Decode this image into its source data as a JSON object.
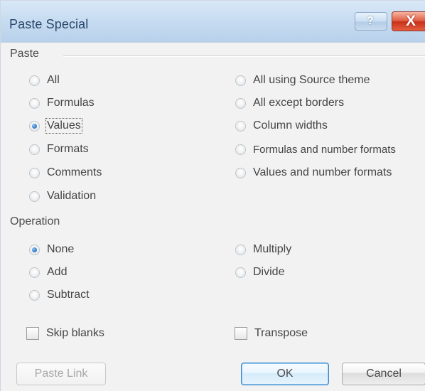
{
  "window": {
    "title": "Paste Special",
    "help_symbol": "?",
    "close_symbol": "X"
  },
  "paste": {
    "title": "Paste",
    "options_left": [
      {
        "label": "All",
        "selected": false
      },
      {
        "label": "Formulas",
        "selected": false
      },
      {
        "label": "Values",
        "selected": true
      },
      {
        "label": "Formats",
        "selected": false
      },
      {
        "label": "Comments",
        "selected": false
      },
      {
        "label": "Validation",
        "selected": false
      }
    ],
    "options_right": [
      {
        "label": "All using Source theme",
        "selected": false
      },
      {
        "label": "All except borders",
        "selected": false
      },
      {
        "label": "Column widths",
        "selected": false
      },
      {
        "label": "Formulas and number formats",
        "selected": false
      },
      {
        "label": "Values and number formats",
        "selected": false
      }
    ]
  },
  "operation": {
    "title": "Operation",
    "options_left": [
      {
        "label": "None",
        "selected": true
      },
      {
        "label": "Add",
        "selected": false
      },
      {
        "label": "Subtract",
        "selected": false
      }
    ],
    "options_right": [
      {
        "label": "Multiply",
        "selected": false
      },
      {
        "label": "Divide",
        "selected": false
      }
    ]
  },
  "checkboxes": {
    "skip_blanks": {
      "label": "Skip blanks",
      "checked": false
    },
    "transpose": {
      "label": "Transpose",
      "checked": false
    }
  },
  "buttons": {
    "paste_link": {
      "label": "Paste Link",
      "enabled": false
    },
    "ok": {
      "label": "OK",
      "enabled": true
    },
    "cancel": {
      "label": "Cancel",
      "enabled": true
    }
  },
  "colors": {
    "title_text": "#29476b",
    "close_button": "#c8311b",
    "selected_radio": "#3b83cf",
    "default_button_border": "#3a87c8"
  },
  "icons": {
    "help": "help-icon",
    "close": "close-icon"
  }
}
